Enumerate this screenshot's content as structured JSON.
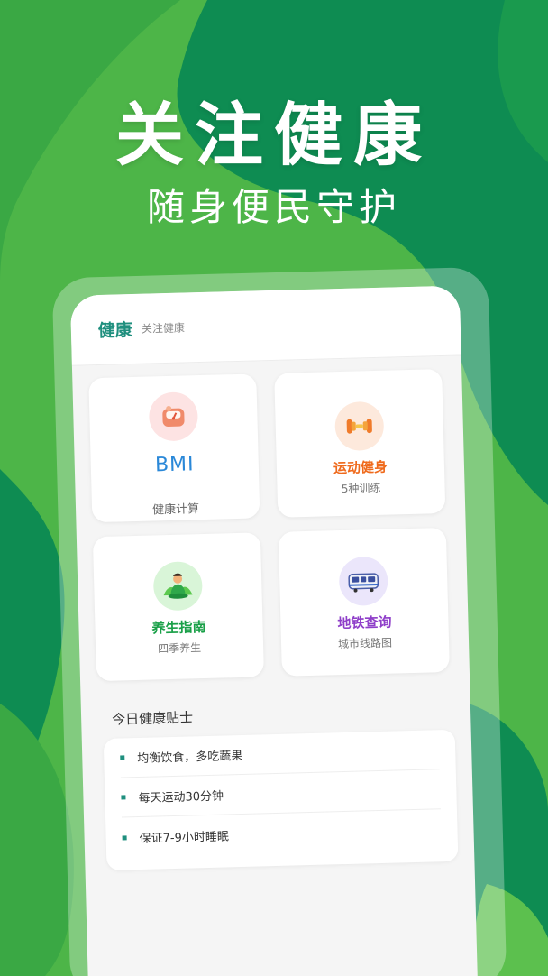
{
  "promo": {
    "headline": "关注健康",
    "subline": "随身便民守护"
  },
  "app": {
    "title": "健康",
    "subtitle": "关注健康"
  },
  "tiles": [
    {
      "title": "BMI",
      "subtitle": "健康计算",
      "icon": "scale-icon",
      "color": "#2a88d8"
    },
    {
      "title": "运动健身",
      "subtitle": "5种训练",
      "icon": "dumbbell-icon",
      "color": "#ef6a1c"
    },
    {
      "title": "养生指南",
      "subtitle": "四季养生",
      "icon": "meditation-icon",
      "color": "#1aa048"
    },
    {
      "title": "地铁查询",
      "subtitle": "城市线路图",
      "icon": "metro-train-icon",
      "color": "#8f3fc9"
    }
  ],
  "tips": {
    "heading": "今日健康贴士",
    "items": [
      "均衡饮食，多吃蔬果",
      "每天运动30分钟",
      "保证7-9小时睡眠"
    ]
  },
  "colors": {
    "background_green": "#4fb84a",
    "dark_green": "#0e8c52",
    "accent_teal": "#1f8f7e"
  }
}
